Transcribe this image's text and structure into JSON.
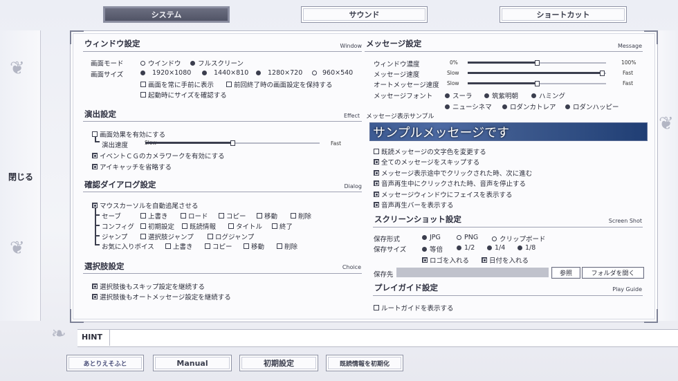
{
  "tabs": [
    {
      "label": "システム",
      "active": true
    },
    {
      "label": "サウンド",
      "active": false
    },
    {
      "label": "ショートカット",
      "active": false
    }
  ],
  "side": {
    "close_label": "閉じる"
  },
  "window": {
    "title": "ウィンドウ設定",
    "title_en": "Window",
    "mode_label": "画面モード",
    "mode_options": [
      "ウインドウ",
      "フルスクリーン"
    ],
    "size_label": "画面サイズ",
    "size_options": [
      "1920×1080",
      "1440×810",
      "1280×720",
      "960×540"
    ],
    "check_front": "画面を常に手前に表示",
    "check_keep": "前回終了時の画面設定を保持する",
    "check_confirm": "起動時にサイズを確認する"
  },
  "effect": {
    "title": "演出設定",
    "title_en": "Effect",
    "check_effect": "画面効果を有効にする",
    "speed_label": "演出速度",
    "slow": "Slow",
    "fast": "Fast",
    "speed_value": 0.5,
    "check_camera": "イベントＣＧのカメラワークを有効にする",
    "check_eyecatch": "アイキャッチを省略する"
  },
  "dialog": {
    "title": "確認ダイアログ設定",
    "title_en": "Dialog",
    "check_mouse": "マウスカーソルを自動追尾させる",
    "rows": [
      {
        "label": "セーブ",
        "items": [
          "上書き",
          "ロード",
          "コピー",
          "移動",
          "削除"
        ]
      },
      {
        "label": "コンフィグ",
        "items": [
          "初期設定",
          "既読情報",
          "タイトル",
          "終了"
        ]
      },
      {
        "label": "ジャンプ",
        "items": [
          "選択肢ジャンプ",
          "ログジャンプ"
        ]
      },
      {
        "label": "お気に入りボイス",
        "items": [
          "上書き",
          "コピー",
          "移動",
          "削除"
        ]
      }
    ]
  },
  "choice": {
    "title": "選択肢設定",
    "title_en": "Choice",
    "check_skip": "選択肢後もスキップ設定を継続する",
    "check_auto": "選択肢後もオートメッセージ設定を継続する"
  },
  "message": {
    "title": "メッセージ設定",
    "title_en": "Message",
    "opacity_label": "ウィンドウ濃度",
    "opacity_min": "0%",
    "opacity_max": "100%",
    "opacity_value": 0.5,
    "speed_label": "メッセージ速度",
    "speed_slow": "Slow",
    "speed_fast": "Fast",
    "speed_value": 0.97,
    "auto_label": "オートメッセージ速度",
    "auto_slow": "Slow",
    "auto_fast": "Fast",
    "auto_value": 0.5,
    "font_label": "メッセージフォント",
    "fonts": [
      "スーラ",
      "筑紫明朝",
      "ハミング",
      "ニューシネマ",
      "ロダンカトレア",
      "ロダンハッピー"
    ]
  },
  "sample": {
    "title": "メッセージ表示サンプル",
    "text": "サンプルメッセージです",
    "checks": [
      "既読メッセージの文字色を変更する",
      "全てのメッセージをスキップする",
      "メッセージ表示途中でクリックされた時、次に進む",
      "音声再生中にクリックされた時、音声を停止する",
      "メッセージウィンドウにフェイスを表示する",
      "音声再生バーを表示する"
    ]
  },
  "screenshot": {
    "title": "スクリーンショット設定",
    "title_en": "Screen Shot",
    "format_label": "保存形式",
    "formats": [
      "JPG",
      "PNG",
      "クリップボード"
    ],
    "size_label": "保存サイズ",
    "sizes": [
      "等倍",
      "1/2",
      "1/4",
      "1/8"
    ],
    "check_logo": "ロゴを入れる",
    "check_date": "日付を入れる",
    "dest_label": "保存先",
    "browse": "参照",
    "open_folder": "フォルダを開く"
  },
  "playguide": {
    "title": "プレイガイド設定",
    "title_en": "Play Guide",
    "check_route": "ルートガイドを表示する"
  },
  "hint": {
    "label": "HINT"
  },
  "bottom": {
    "logo": "あとりえそふと",
    "manual": "Manual",
    "reset": "初期設定",
    "clear_read": "既読情報を初期化"
  }
}
